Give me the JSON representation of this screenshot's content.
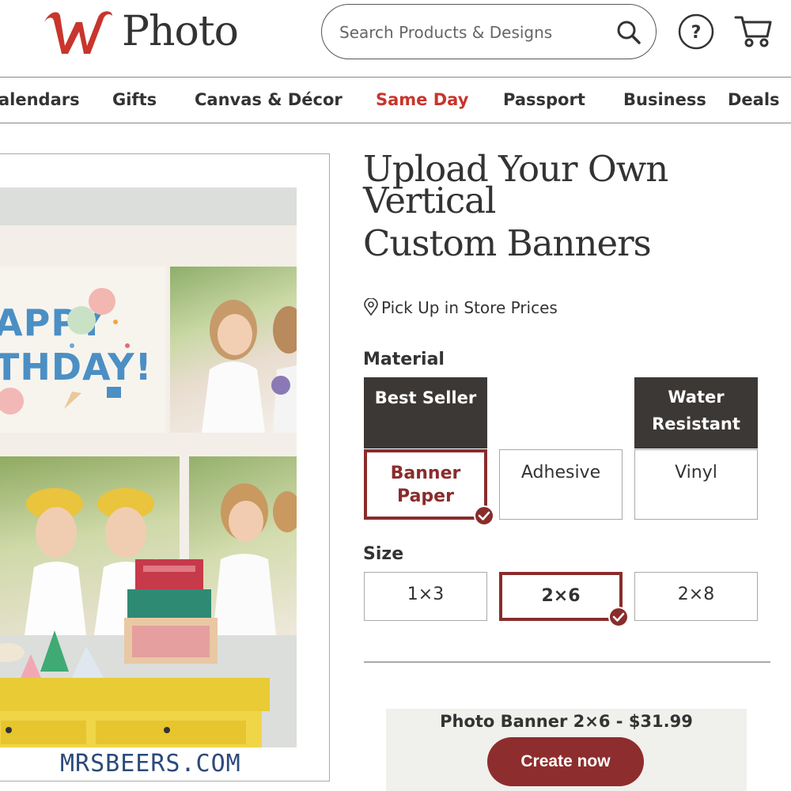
{
  "header": {
    "brand_text": "Photo",
    "brand_letter": "W",
    "search_placeholder": "Search Products & Designs"
  },
  "nav": {
    "items": [
      "alendars",
      "Gifts",
      "Canvas & Décor",
      "Same Day",
      "Passport",
      "Business",
      "Deals"
    ],
    "active": "Same Day"
  },
  "product_image": {
    "card_line1": "APPY",
    "card_line2": "THDAY!",
    "watermark": "MRSBEERS.COM"
  },
  "product": {
    "title_line1": "Upload Your Own",
    "title_line2": "Vertical",
    "title_line3": "Custom Banners",
    "pickup_text": "Pick Up in Store Prices"
  },
  "material": {
    "label": "Material",
    "flags": {
      "banner_paper": "Best Seller",
      "vinyl_line1": "Water",
      "vinyl_line2": "Resistant"
    },
    "options": {
      "banner_paper_line1": "Banner",
      "banner_paper_line2": "Paper",
      "adhesive": "Adhesive",
      "vinyl": "Vinyl"
    },
    "selected": "Banner Paper"
  },
  "size": {
    "label": "Size",
    "options": [
      "1×3",
      "2×6",
      "2×8"
    ],
    "selected": "2×6"
  },
  "purchase": {
    "summary": "Photo Banner 2×6 - $31.99",
    "button": "Create now"
  },
  "colors": {
    "brand_red": "#c8352c",
    "selected_border": "#8a2c2c",
    "button": "#8e2d2d",
    "flag_bg": "#3c3836"
  }
}
